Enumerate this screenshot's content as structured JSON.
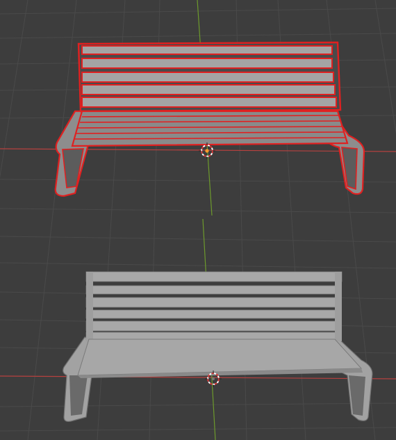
{
  "scene": {
    "background": "#3d3d3d",
    "grid_color": "#4a4a4a",
    "grid_minor_color": "#444444",
    "x_axis_color": "#b8413f",
    "y_axis_color": "#6d9a2c",
    "selection_outline_color": "#e02020",
    "mesh_color": "#9b9b9b",
    "mesh_dark": "#6f6f6f",
    "origin_marker_color": "#ff9a2a",
    "cursor_color_a": "#ffffff",
    "cursor_color_b": "#d83a3a"
  },
  "objects": [
    {
      "name": "bench-selected",
      "state": "selected",
      "icon": "mesh-object-icon"
    },
    {
      "name": "bench-unselected",
      "state": "unselected",
      "icon": "mesh-object-icon"
    }
  ],
  "cursor_icon": "3d-cursor-icon"
}
